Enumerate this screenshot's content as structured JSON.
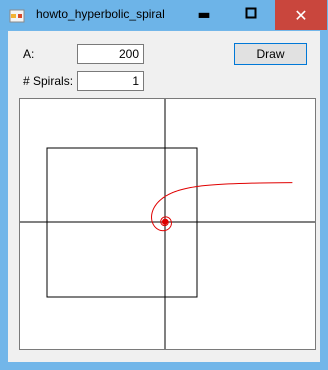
{
  "window": {
    "title": "howto_hyperbolic_spiral",
    "controls": {
      "minimize_icon": "minimize-icon",
      "maximize_icon": "maximize-icon",
      "close_icon": "close-icon"
    }
  },
  "form": {
    "a_label": "A:",
    "a_value": "200",
    "spirals_label": "# Spirals:",
    "spirals_value": "1",
    "draw_label": "Draw"
  },
  "colors": {
    "spiral": "#e00000",
    "axes": "#000000",
    "square": "#000000"
  }
}
